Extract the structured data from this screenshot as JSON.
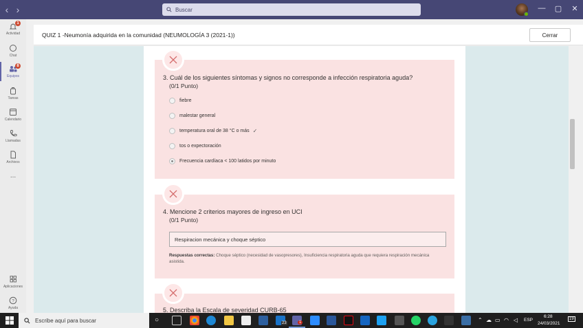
{
  "titlebar": {
    "search_placeholder": "Buscar",
    "back": "‹",
    "forward": "›",
    "minimize": "—",
    "maximize": "▢",
    "close": "✕"
  },
  "rail": {
    "items": [
      {
        "label": "Actividad",
        "icon": "bell-icon",
        "badge": "1"
      },
      {
        "label": "Chat",
        "icon": "chat-icon"
      },
      {
        "label": "Equipos",
        "icon": "teams-icon",
        "badge": "8"
      },
      {
        "label": "Tareas",
        "icon": "backpack-icon"
      },
      {
        "label": "Calendario",
        "icon": "calendar-icon"
      },
      {
        "label": "Llamadas",
        "icon": "phone-icon"
      },
      {
        "label": "Archivos",
        "icon": "file-icon"
      },
      {
        "label": "...",
        "icon": "more-icon"
      },
      {
        "label": "Aplicaciones",
        "icon": "apps-icon"
      },
      {
        "label": "Ayuda",
        "icon": "help-icon"
      }
    ]
  },
  "header": {
    "title": "QUIZ 1 -Neumonía adquirida en la comunidad (NEUMOLOGÍA 3 (2021-1))",
    "close_label": "Cerrar"
  },
  "questions": [
    {
      "title": "3. Cuál de los siguientes síntomas y signos no corresponde a infección respiratoria aguda?",
      "points": "(0/1 Punto)",
      "options": [
        {
          "label": "fiebre",
          "selected": false,
          "correct": false
        },
        {
          "label": "malestar general",
          "selected": false,
          "correct": false
        },
        {
          "label": "temperatura oral de 38 °C o más",
          "selected": false,
          "correct": true
        },
        {
          "label": "tos o expectoración",
          "selected": false,
          "correct": false
        },
        {
          "label": "Frecuencia cardíaca < 100 latidos por minuto",
          "selected": true,
          "correct": false
        }
      ]
    },
    {
      "title": "4. Mencione 2 criterios mayores de ingreso en UCI",
      "points": "(0/1 Punto)",
      "answer": "Respiracion mecánica y choque séptico",
      "correct_label": "Respuestas correctas:",
      "correct_text": "Choque séptico (necesidad de vasopresores), Insuficiencia respiratoria aguda que requiera respiración mecánica asistida."
    },
    {
      "title": "5. Describa la Escala de severidad CURB-65"
    }
  ],
  "taskbar": {
    "search_placeholder": "Escribe aquí para buscar",
    "language": "ESP",
    "time": "6:28",
    "date": "24/03/2021",
    "notif_count": "19",
    "teams_badge": "1",
    "mail_badge": "23"
  },
  "colors": {
    "titlebar": "#464775",
    "accent": "#6264a7",
    "wrong_card": "#fae2e2",
    "background": "#dbeaec"
  }
}
